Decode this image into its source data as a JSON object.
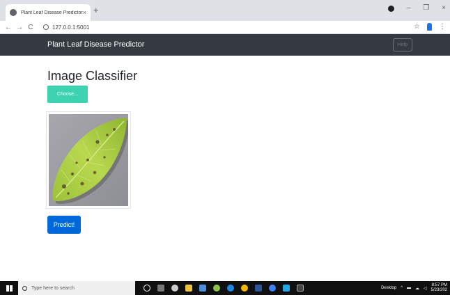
{
  "browser": {
    "tab_title": "Plant Leaf Disease Predictor",
    "tab_close": "×",
    "new_tab": "+",
    "url": "127.0.0.1:5001",
    "nav_back": "←",
    "nav_forward": "→",
    "nav_reload": "C",
    "star": "☆",
    "menu": "⋮",
    "win_min": "–",
    "win_max": "❐",
    "win_close": "×"
  },
  "navbar": {
    "brand": "Plant Leaf Disease Predictor",
    "help_label": "Help"
  },
  "main": {
    "heading": "Image Classifier",
    "choose_label": "Choose...",
    "predict_label": "Predict!"
  },
  "taskbar": {
    "search_placeholder": "Type here to search",
    "desktop_label": "Desktop",
    "time": "8:57 PM",
    "date": "5/23/202"
  },
  "colors": {
    "navbar_bg": "#343a40",
    "choose_btn": "#3dd3b0",
    "predict_btn": "#0069d9"
  }
}
